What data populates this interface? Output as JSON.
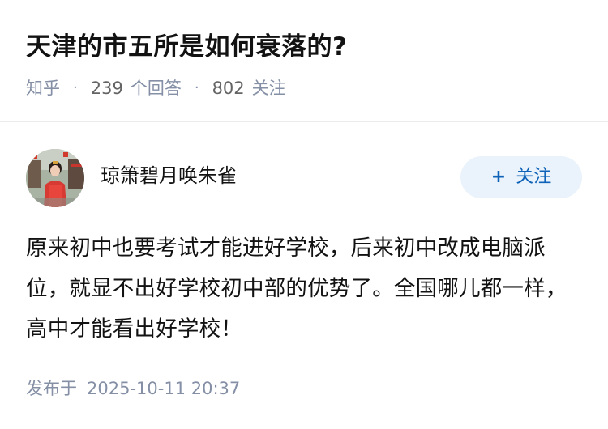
{
  "question": {
    "title": "天津的市五所是如何衰落的?",
    "source": "知乎",
    "separator": "·",
    "answer_count": "239",
    "answer_label": "个回答",
    "follower_count": "802",
    "follower_label": "关注"
  },
  "author": {
    "name": "琼箫碧月唤朱雀",
    "avatar_icon": "avatar-photo"
  },
  "follow_button": {
    "plus": "+",
    "label": "关注",
    "color": "#0e62b8",
    "background": "#eaf3fb"
  },
  "answer": {
    "content": "原来初中也要考试才能进好学校，后来初中改成电脑派位，就显不出好学校初中部的优势了。全国哪儿都一样，高中才能看出好学校！"
  },
  "publish": {
    "label": "发布于",
    "time": "2025-10-11 20:37"
  },
  "colors": {
    "title": "#121212",
    "meta": "#8590a6",
    "divider": "#ebebeb"
  }
}
